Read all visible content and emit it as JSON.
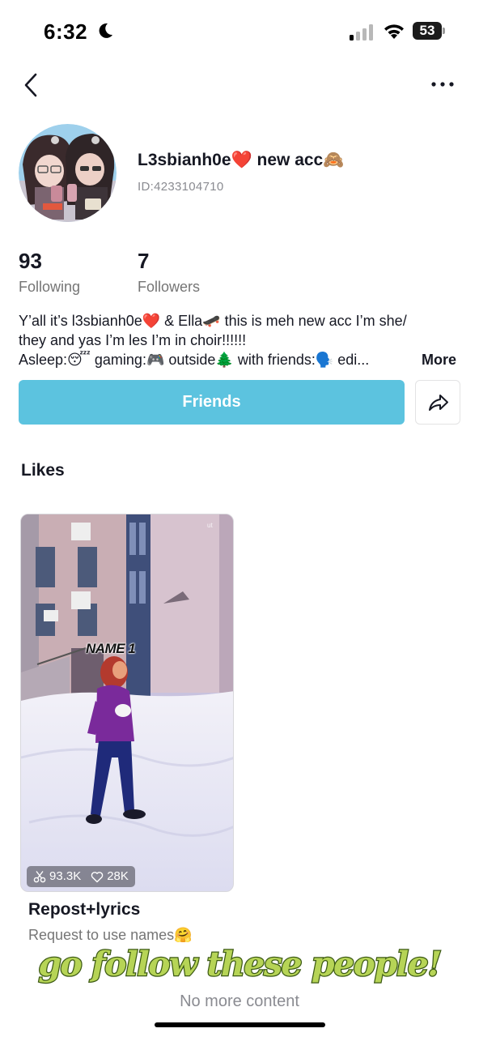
{
  "status_bar": {
    "time": "6:32",
    "battery": "53"
  },
  "profile": {
    "name": "L3sbianh0e❤️ new acc🙈",
    "id": "ID:4233104710",
    "following_count": "93",
    "following_label": "Following",
    "followers_count": "7",
    "followers_label": "Followers",
    "bio_lines": [
      "Y’all it’s l3sbianh0e❤️ & Ella🛹 this is meh new acc I’m she/",
      "they and yas I’m les I’m in choir!!!!!!",
      "Asleep:😴 gaming:🎮 outside🌲 with friends:🗣️ edi..."
    ],
    "bio_more": "More",
    "friends_button": "Friends"
  },
  "likes": {
    "title": "Likes",
    "items": [
      {
        "overlay_label": "NAME 1",
        "remix_count": "93.3K",
        "like_count": "28K",
        "title": "Repost+lyrics",
        "description": "Request to use names🤗"
      }
    ]
  },
  "overlay_caption": "go follow these people!",
  "footer": {
    "no_more": "No more content"
  },
  "colors": {
    "accent": "#5cc3df",
    "caption_fill": "#b6d456",
    "caption_stroke": "#3c5a14"
  }
}
